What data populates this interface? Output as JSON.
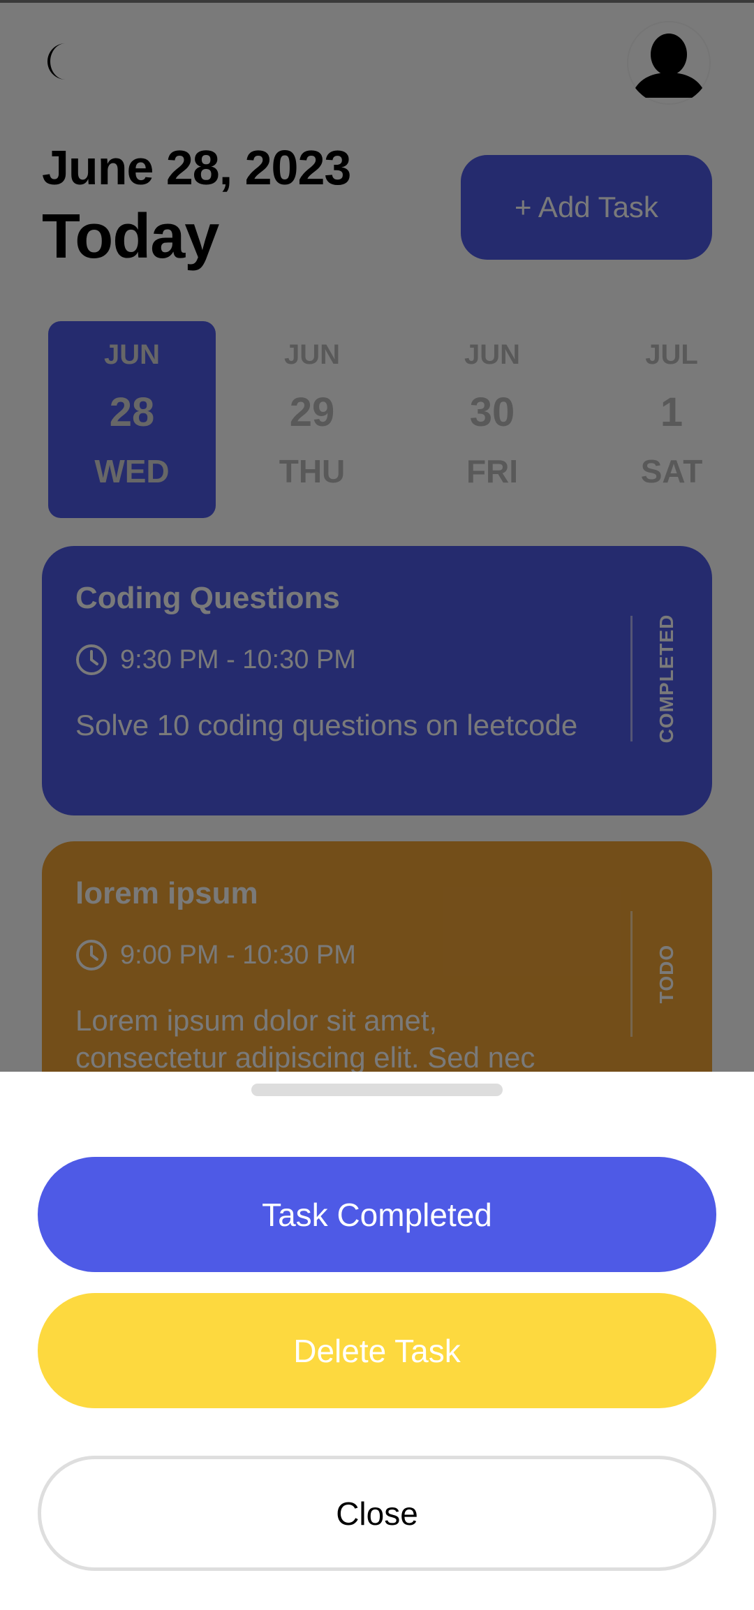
{
  "header": {
    "date": "June 28, 2023",
    "title": "Today",
    "add_task_label": "+ Add Task",
    "theme_icon": "moon-icon",
    "avatar_icon": "user-avatar-icon"
  },
  "date_strip": [
    {
      "month": "JUN",
      "day": "28",
      "weekday": "WED",
      "selected": true
    },
    {
      "month": "JUN",
      "day": "29",
      "weekday": "THU",
      "selected": false
    },
    {
      "month": "JUN",
      "day": "30",
      "weekday": "FRI",
      "selected": false
    },
    {
      "month": "JUL",
      "day": "1",
      "weekday": "SAT",
      "selected": false
    }
  ],
  "tasks": [
    {
      "title": "Coding Questions",
      "time": "9:30 PM - 10:30 PM",
      "description": "Solve 10 coding questions on leetcode",
      "status": "COMPLETED",
      "color": "#4e5ae6"
    },
    {
      "title": "lorem ipsum",
      "time": "9:00 PM - 10:30 PM",
      "description": "Lorem ipsum dolor sit amet, consectetur adipiscing elit. Sed nec",
      "status": "TODO",
      "color": "#f0a436"
    }
  ],
  "sheet": {
    "complete_label": "Task Completed",
    "delete_label": "Delete Task",
    "close_label": "Close"
  },
  "colors": {
    "primary": "#4e5ae6",
    "accent_yellow": "#fdd93f",
    "task_orange": "#f0a436",
    "overlay": "rgba(0,0,0,0.52)"
  }
}
